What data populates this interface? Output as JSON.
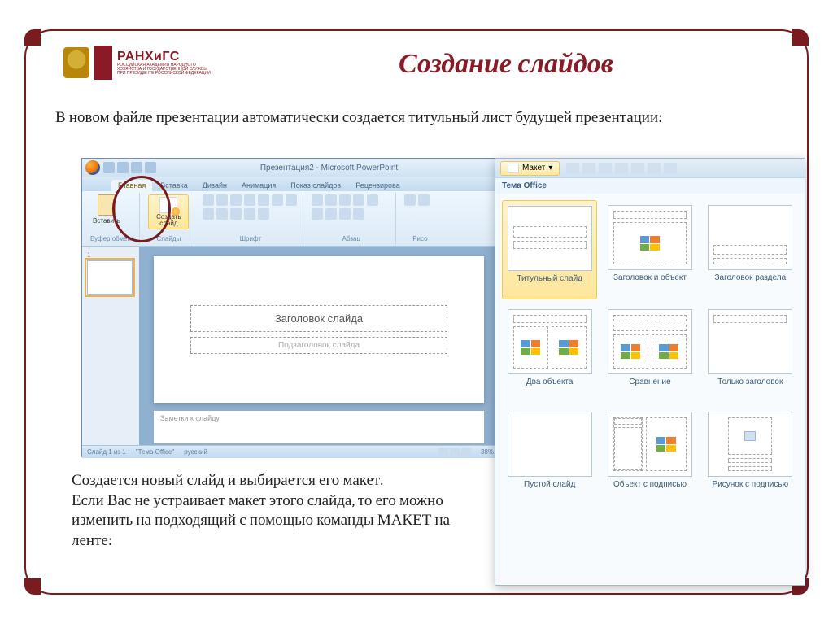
{
  "page": {
    "logo_main": "РАНХиГС",
    "logo_sub": "РОССИЙСКАЯ АКАДЕМИЯ НАРОДНОГО ХОЗЯЙСТВА И ГОСУДАРСТВЕННОЙ СЛУЖБЫ ПРИ ПРЕЗИДЕНТЕ РОССИЙСКОЙ ФЕДЕРАЦИИ",
    "title": "Создание слайдов",
    "intro": "В новом файле презентации автоматически создается титульный лист будущей презентации:",
    "outro": "Создается новый слайд и выбирается его макет.\nЕсли Вас не устраивает макет этого слайда, то его можно изменить на подходящий с помощью команды МАКЕТ на ленте:"
  },
  "ppt": {
    "window_title": "Презентация2 - Microsoft PowerPoint",
    "tabs": [
      "Главная",
      "Вставка",
      "Дизайн",
      "Анимация",
      "Показ слайдов",
      "Рецензирова"
    ],
    "paste_label": "Вставить",
    "newslide_label": "Создать слайд",
    "groups": {
      "clipboard": "Буфер обмена",
      "slides": "Слайды",
      "font": "Шрифт",
      "paragraph": "Абзац",
      "draw": "Рисо"
    },
    "slide_title_ph": "Заголовок слайда",
    "slide_sub_ph": "Подзаголовок слайда",
    "notes_ph": "Заметки к слайду",
    "status": {
      "slide": "Слайд 1 из 1",
      "theme": "\"Тема Office\"",
      "lang": "русский",
      "zoom": "38%"
    }
  },
  "popup": {
    "maket_label": "Макет",
    "theme": "Тема Office",
    "layouts": [
      "Титульный слайд",
      "Заголовок и объект",
      "Заголовок раздела",
      "Два объекта",
      "Сравнение",
      "Только заголовок",
      "Пустой слайд",
      "Объект с подписью",
      "Рисунок с подписью"
    ]
  }
}
